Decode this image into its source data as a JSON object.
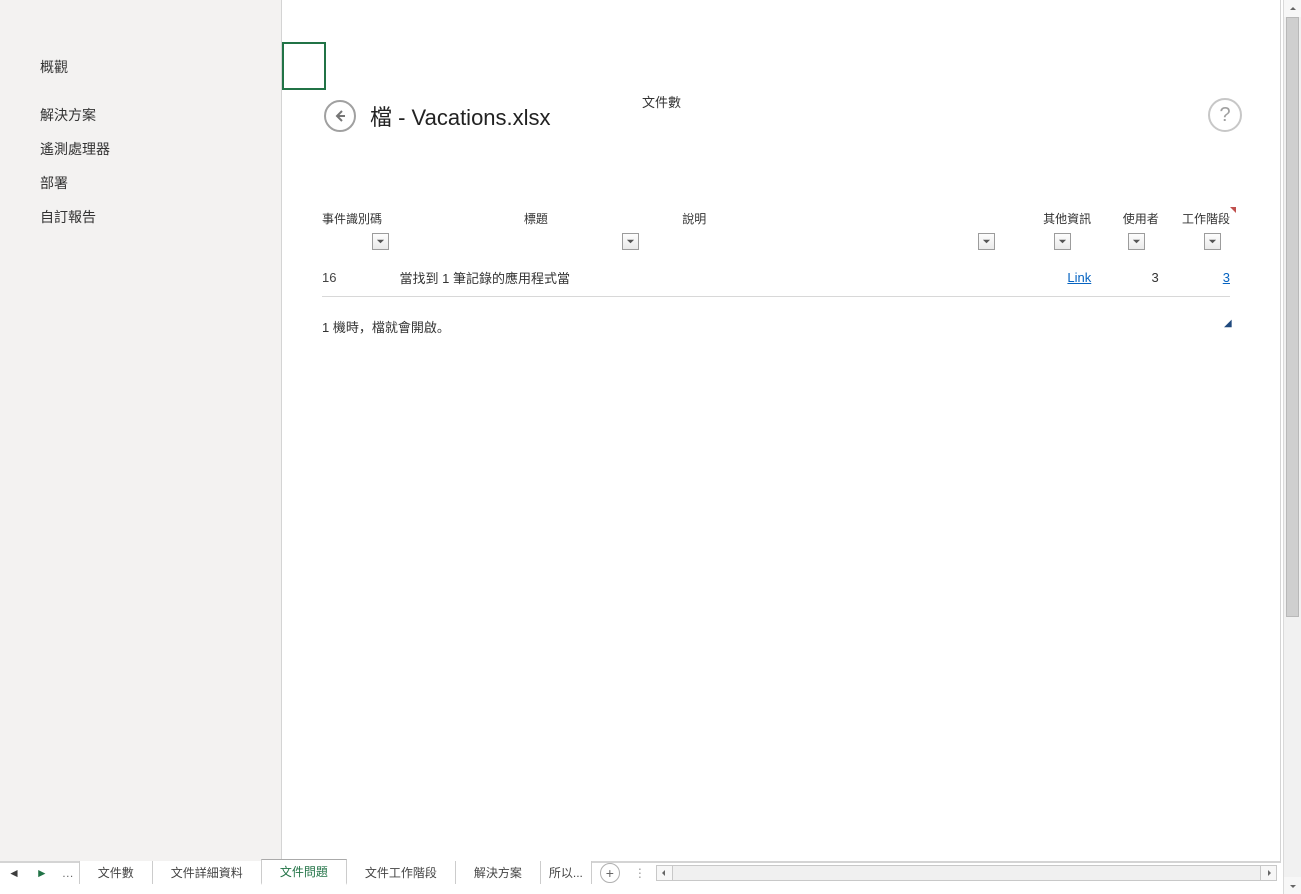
{
  "sidebar": {
    "items": [
      {
        "label": "概觀"
      },
      {
        "label": "解決方案"
      },
      {
        "label": "遙測處理器"
      },
      {
        "label": "部署"
      },
      {
        "label": "自訂報告"
      }
    ]
  },
  "breadcrumb": "文件數",
  "page_title": "檔 - Vacations.xlsx",
  "columns": {
    "id": "事件識別碼",
    "title": "標題",
    "desc": "說明",
    "other": "其他資訊",
    "user": "使用者",
    "stage": "工作階段"
  },
  "row": {
    "id": "16",
    "title": "當找到 1 筆記錄的應用程式當",
    "link": "Link",
    "user": "3",
    "stage": "3"
  },
  "footer_note": "1 機時，檔就會開啟。",
  "tabs": {
    "t1": "文件數",
    "t2": "文件詳細資料",
    "t3": "文件問題",
    "t4": "文件工作階段",
    "t5": "解決方案",
    "t6": "所以..."
  }
}
